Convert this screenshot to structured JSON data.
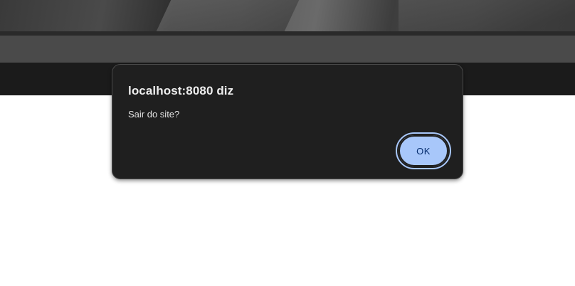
{
  "dialog": {
    "title": "localhost:8080 diz",
    "message": "Sair do site?",
    "ok_label": "OK"
  },
  "colors": {
    "dialog_background": "#1f1f1f",
    "dialog_border": "#4a4a4a",
    "button_background": "#a8c7fa",
    "button_text": "#062e6f",
    "page_background": "#ffffff"
  }
}
